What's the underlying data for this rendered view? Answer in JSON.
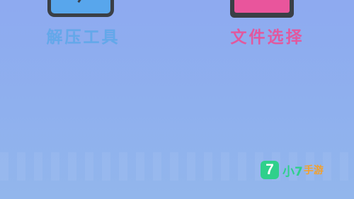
{
  "tools": [
    {
      "label": "解压工具",
      "icon": "unzip-tool-icon",
      "label_color": "#63a8ea",
      "tile_color": "#58a6ec"
    },
    {
      "label": "文件选择",
      "icon": "file-select-icon",
      "label_color": "#e2589e",
      "tile_color": "#e9559c"
    }
  ],
  "watermark": {
    "badge": "7",
    "brand": "小7",
    "brand_accent": "手游",
    "brand_color": "#2fd08b",
    "accent_color": "#f4a12b"
  },
  "background_color": "#8eaaf0"
}
